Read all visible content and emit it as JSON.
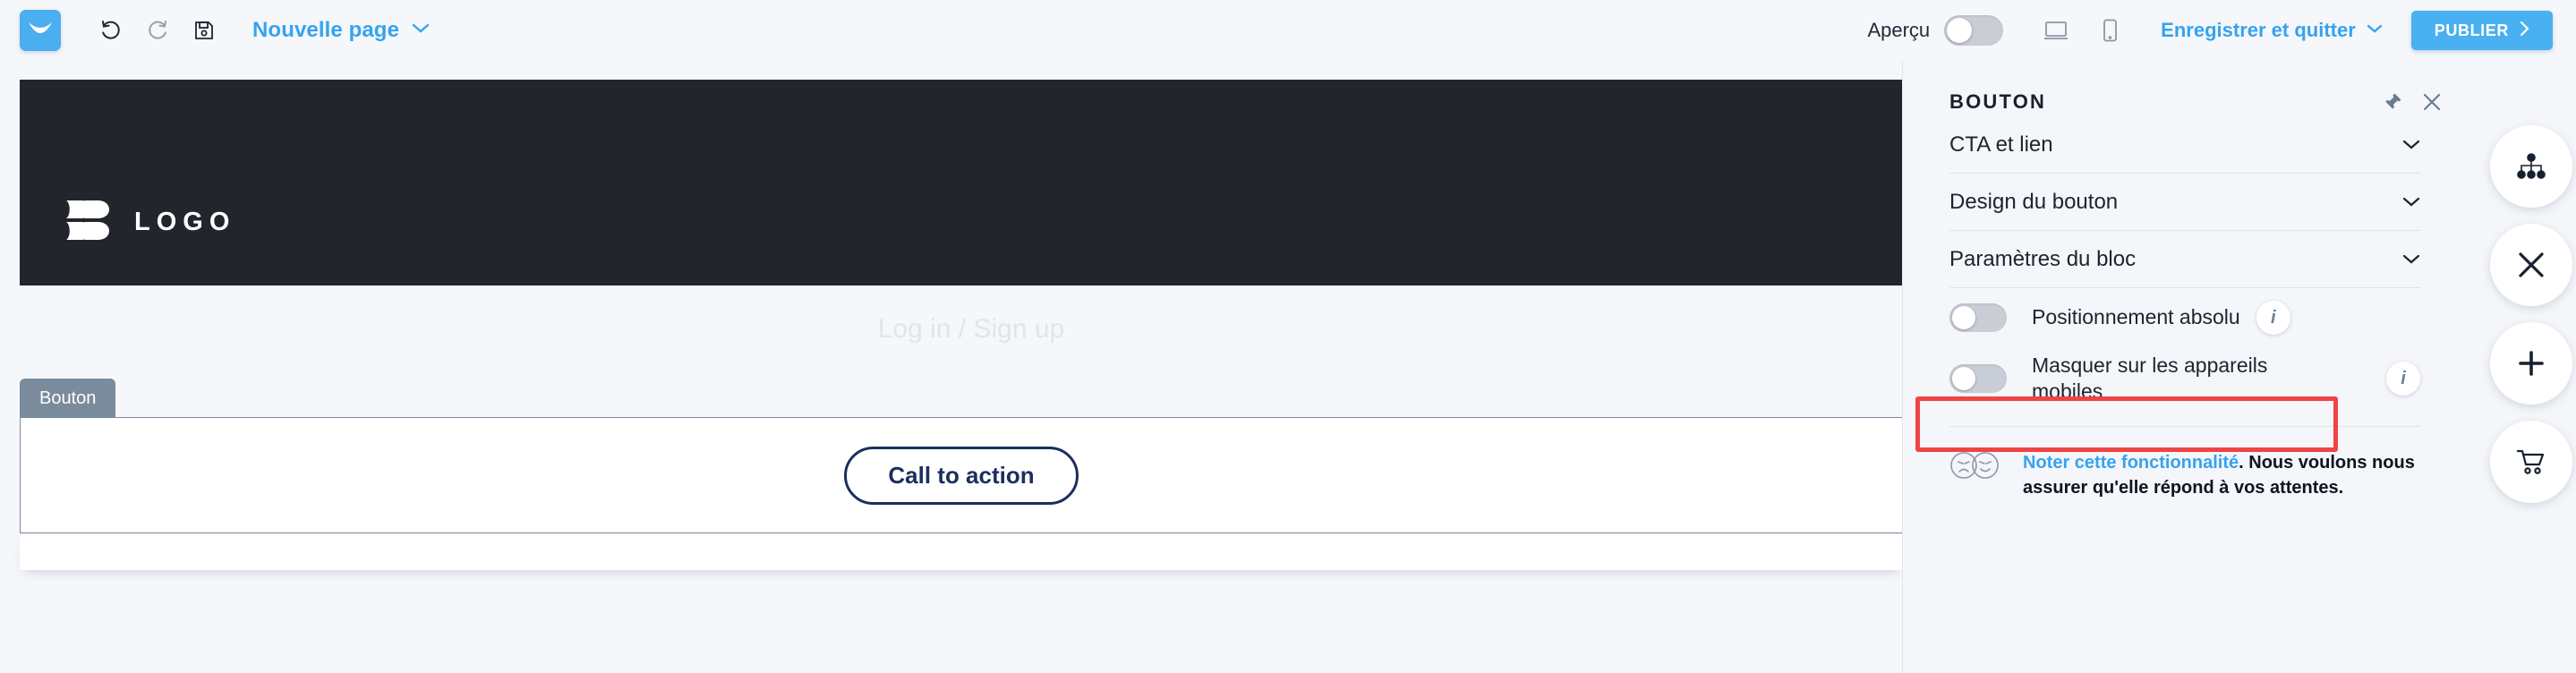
{
  "topbar": {
    "logo_icon": "brevo-envelope-logo",
    "undo_icon": "undo-icon",
    "redo_icon": "redo-icon",
    "save_icon": "floppy-disk-save-icon",
    "page_name": "Nouvelle page",
    "page_name_chevron": "chevron-down-icon",
    "preview_label": "Aperçu",
    "preview_toggle_state": "off",
    "desktop_icon": "desktop-monitor-icon",
    "mobile_icon": "mobile-phone-icon",
    "save_exit_label": "Enregistrer et quitter",
    "save_exit_chevron": "chevron-down-icon",
    "publish_label": "PUBLIER",
    "publish_arrow": "chevron-right-icon",
    "accent_color": "#35a3ef",
    "publish_bg": "#49b0f1"
  },
  "canvas": {
    "site_header_bg": "#22262c",
    "brand_text": "LOGO",
    "brand_mark_icon": "bb-logo-mark",
    "hero_link": "Log in / Sign up",
    "block_tab_label": "Bouton",
    "cta_label": "Call to action",
    "cta_color": "#1b2f5e"
  },
  "panel": {
    "title": "BOUTON",
    "pin_icon": "pin-icon",
    "close_icon": "close-icon",
    "accordions": [
      {
        "label": "CTA et lien",
        "chevron": "chevron-down-icon"
      },
      {
        "label": "Design du bouton",
        "chevron": "chevron-down-icon"
      },
      {
        "label": "Paramètres du bloc",
        "chevron": "chevron-down-icon"
      }
    ],
    "toggles": [
      {
        "label": "Positionnement absolu",
        "state": "off",
        "info_icon": "info-icon",
        "highlighted": true
      },
      {
        "label": "Masquer sur les appareils mobiles",
        "state": "off",
        "info_icon": "info-icon",
        "highlighted": false
      }
    ],
    "highlight_color": "#ef4444",
    "feedback": {
      "faces_icon": "sad-happy-faces-icon",
      "link_text": "Noter cette fonctionnalité",
      "rest_text": ". Nous voulons nous assurer qu'elle répond à vos attentes."
    }
  },
  "fabs": [
    {
      "icon": "sitemap-hierarchy-icon",
      "name": "structure"
    },
    {
      "icon": "close-icon",
      "name": "close"
    },
    {
      "icon": "plus-icon",
      "name": "add"
    },
    {
      "icon": "shopping-cart-icon",
      "name": "cart"
    }
  ]
}
